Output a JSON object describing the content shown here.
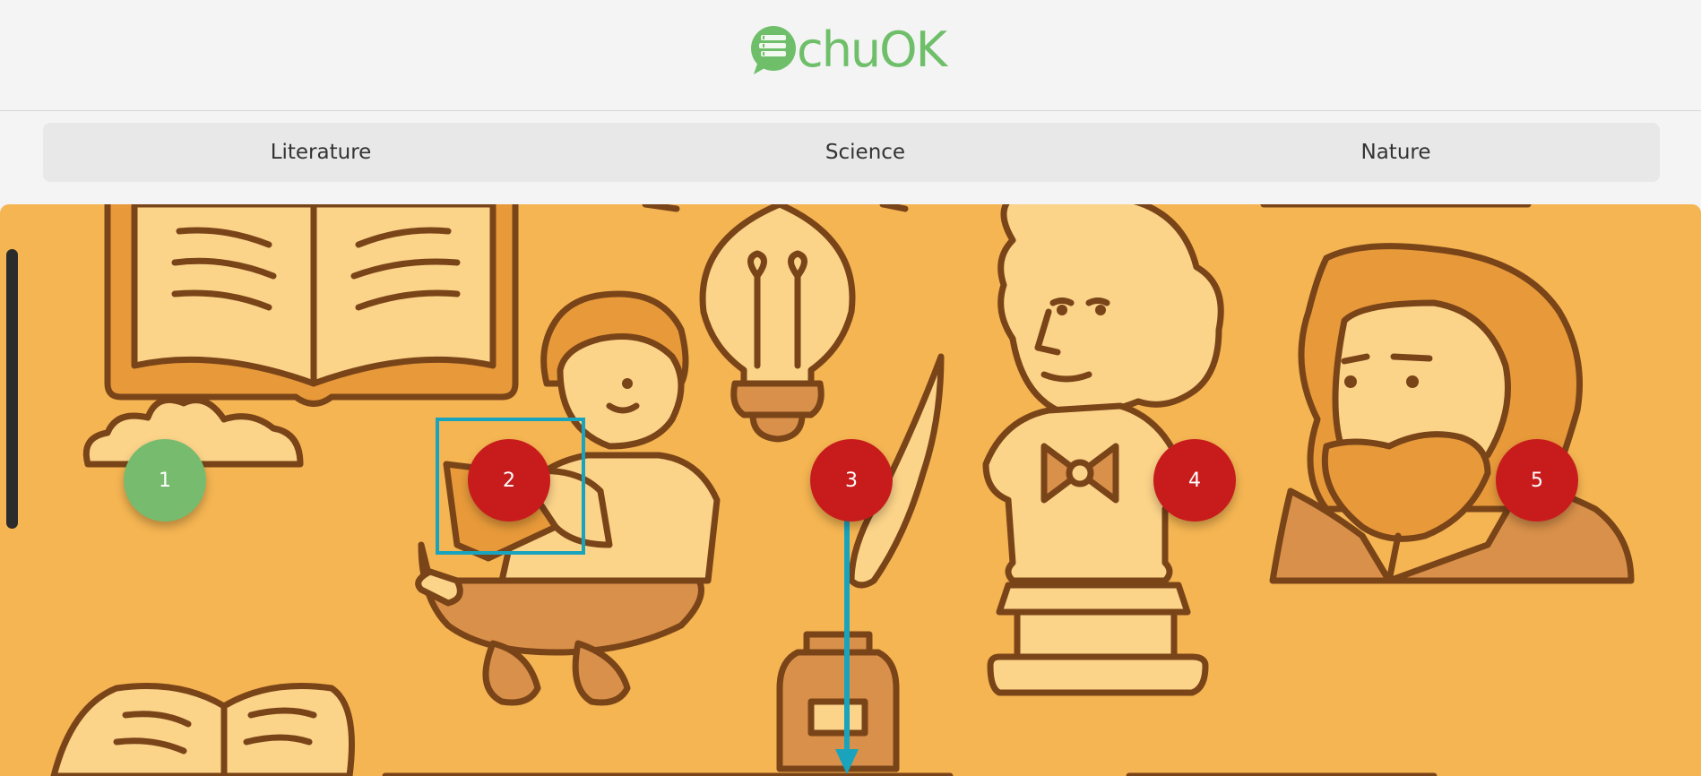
{
  "header": {
    "logo_text": "chuOK"
  },
  "tabs": [
    {
      "label": "Literature"
    },
    {
      "label": "Science"
    },
    {
      "label": "Nature"
    }
  ],
  "markers": [
    {
      "label": "1",
      "state": "completed",
      "color": "#77bb6f"
    },
    {
      "label": "2",
      "state": "locked",
      "color": "#c81c1c"
    },
    {
      "label": "3",
      "state": "locked",
      "color": "#c81c1c"
    },
    {
      "label": "4",
      "state": "locked",
      "color": "#c81c1c"
    },
    {
      "label": "5",
      "state": "locked",
      "color": "#c81c1c"
    }
  ],
  "colors": {
    "brand_green": "#6fbf6a",
    "scene_bg": "#f5b552",
    "highlight": "#19a3bd"
  }
}
